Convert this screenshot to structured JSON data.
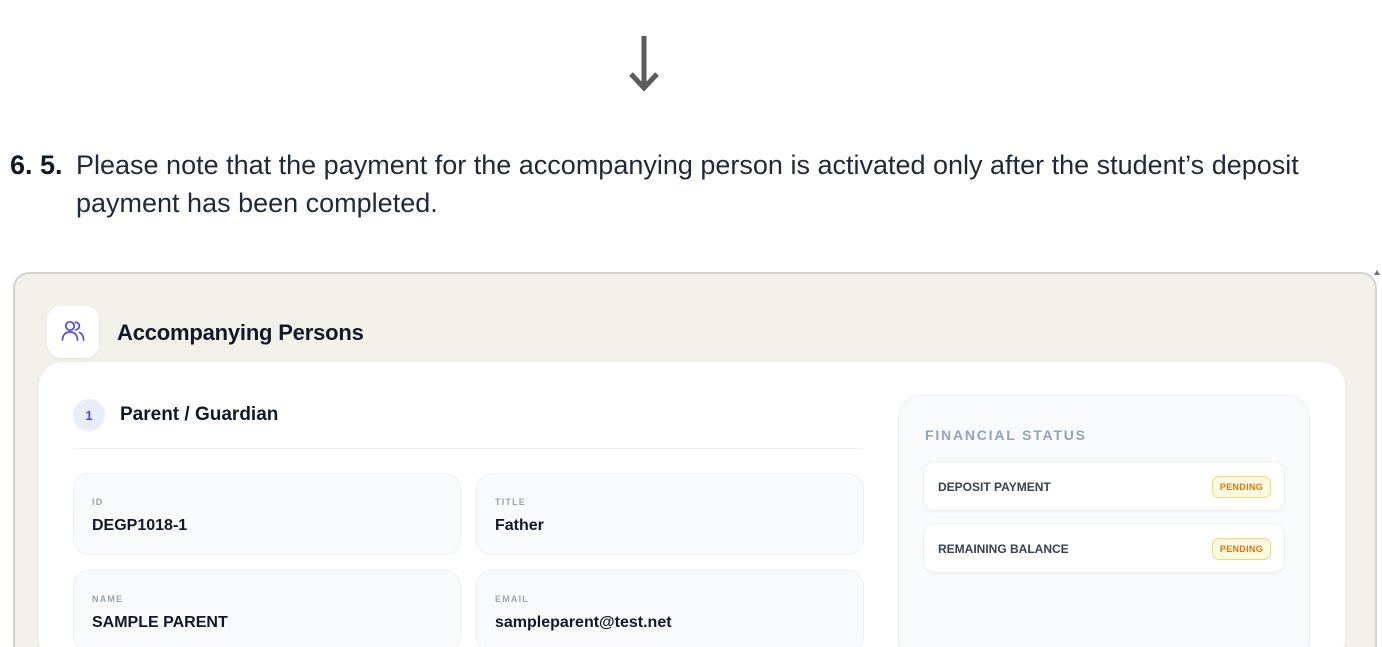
{
  "instruction": {
    "step_number": "6. 5.",
    "text": "Please note that the payment for the accompanying person is activated only after the student’s deposit payment has been completed."
  },
  "section": {
    "title": "Accompanying Persons",
    "icon": "users-icon"
  },
  "person": {
    "index": "1",
    "title": "Parent / Guardian",
    "fields": {
      "id": {
        "label": "ID",
        "value": "DEGP1018-1"
      },
      "title": {
        "label": "TITLE",
        "value": "Father"
      },
      "name": {
        "label": "NAME",
        "value": "SAMPLE PARENT"
      },
      "email": {
        "label": "EMAIL",
        "value": "sampleparent@test.net"
      }
    }
  },
  "financial_status": {
    "title": "FINANCIAL STATUS",
    "items": [
      {
        "label": "DEPOSIT PAYMENT",
        "status": "PENDING"
      },
      {
        "label": "REMAINING BALANCE",
        "status": "PENDING"
      }
    ]
  },
  "colors": {
    "accent": "#4f46e5",
    "frame_bg": "#f1f1ea",
    "pending_text": "#d97706",
    "pending_bg": "#fef9e3",
    "pending_border": "#fcd56a"
  }
}
